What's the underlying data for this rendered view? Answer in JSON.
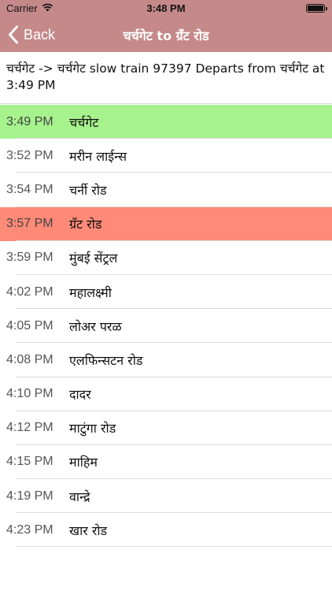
{
  "status_bar": {
    "carrier": "Carrier",
    "time": "3:48 PM"
  },
  "nav": {
    "back_label": "Back",
    "title": "चर्चगेट to ग्रँट रोड"
  },
  "summary": "चर्चगेट -> चर्चगेट slow train 97397 Departs from चर्चगेट at 3:49 PM",
  "highlight_colors": {
    "source": "#a6f28c",
    "destination": "#ff8a77",
    "header": "#c5898a"
  },
  "stops": [
    {
      "time": "3:49 PM",
      "name": "चर्चगेट",
      "kind": "source"
    },
    {
      "time": "3:52 PM",
      "name": "मरीन लाईन्स",
      "kind": ""
    },
    {
      "time": "3:54 PM",
      "name": "चर्नी रोड",
      "kind": ""
    },
    {
      "time": "3:57 PM",
      "name": "ग्रँट रोड",
      "kind": "destination"
    },
    {
      "time": "3:59 PM",
      "name": "मुंबई सेंट्रल",
      "kind": ""
    },
    {
      "time": "4:02 PM",
      "name": "महालक्ष्मी",
      "kind": ""
    },
    {
      "time": "4:05 PM",
      "name": "लोअर परळ",
      "kind": ""
    },
    {
      "time": "4:08 PM",
      "name": "एलफिन्सटन रोड",
      "kind": ""
    },
    {
      "time": "4:10 PM",
      "name": "दादर",
      "kind": ""
    },
    {
      "time": "4:12 PM",
      "name": "माटुंगा रोड",
      "kind": ""
    },
    {
      "time": "4:15 PM",
      "name": "माहिम",
      "kind": ""
    },
    {
      "time": "4:19 PM",
      "name": "वान्द्रे",
      "kind": ""
    },
    {
      "time": "4:23 PM",
      "name": "खार रोड",
      "kind": ""
    }
  ]
}
